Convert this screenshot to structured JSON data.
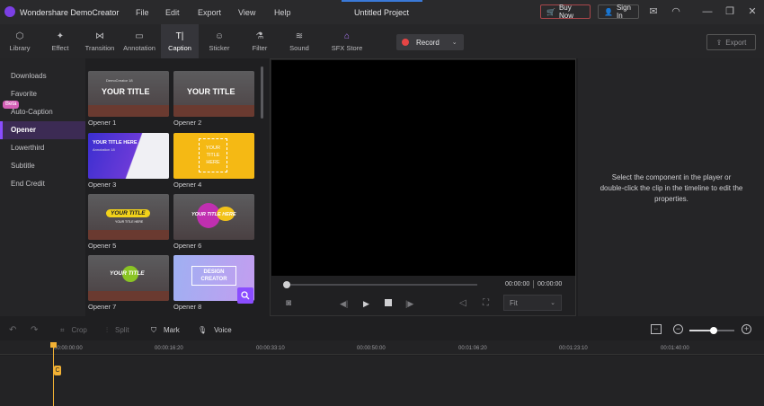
{
  "app": {
    "name": "Wondershare DemoCreator",
    "project_title": "Untitled Project"
  },
  "menu": [
    "File",
    "Edit",
    "Export",
    "View",
    "Help"
  ],
  "titlebar": {
    "buy_now": "Buy Now",
    "sign_in": "Sign In"
  },
  "toolbar": {
    "tools": [
      {
        "label": "Library",
        "icon": "cube-icon"
      },
      {
        "label": "Effect",
        "icon": "magic-wand-icon"
      },
      {
        "label": "Transition",
        "icon": "bowtie-icon"
      },
      {
        "label": "Annotation",
        "icon": "speech-bubble-icon"
      },
      {
        "label": "Caption",
        "icon": "text-cursor-icon"
      },
      {
        "label": "Sticker",
        "icon": "smiley-icon"
      },
      {
        "label": "Filter",
        "icon": "filter-icon"
      },
      {
        "label": "Sound",
        "icon": "waveform-icon"
      },
      {
        "label": "SFX Store",
        "icon": "store-icon"
      }
    ],
    "active_tool": "Caption",
    "record_label": "Record",
    "export_label": "Export"
  },
  "categories": [
    "Downloads",
    "Favorite",
    "Auto-Caption",
    "Opener",
    "Lowerthird",
    "Subtitle",
    "End Credit"
  ],
  "active_category": "Opener",
  "beta_badge": "Beta",
  "templates": [
    {
      "label": "Opener 1",
      "title": "YOUR TITLE",
      "sub": "DemoCreator 18"
    },
    {
      "label": "Opener 2",
      "title": "YOUR TITLE",
      "sub": ""
    },
    {
      "label": "Opener 3",
      "title": "YOUR TITLE HERE",
      "sub": "Annotation 18"
    },
    {
      "label": "Opener 4",
      "title": "YOUR TITLE HERE",
      "sub": ""
    },
    {
      "label": "Opener 5",
      "title": "YOUR TITLE",
      "sub": "YOUR TITLE HERE"
    },
    {
      "label": "Opener 6",
      "title": "YOUR TITLE HERE",
      "sub": ""
    },
    {
      "label": "Opener 7",
      "title": "YOUR TITLE",
      "sub": ""
    },
    {
      "label": "Opener 8",
      "title": "DESIGN CREATOR",
      "sub": ""
    }
  ],
  "player": {
    "current_time": "00:00:00",
    "total_time": "00:00:00",
    "zoom_select": "Fit"
  },
  "properties_hint": "Select the component in the player or double-click the clip in the timeline to edit the properties.",
  "timeline": {
    "tools": [
      "Crop",
      "Split",
      "Mark",
      "Voice"
    ],
    "ticks": [
      "00:00:00:00",
      "00:00:16:20",
      "00:00:33:10",
      "00:00:50:00",
      "00:01:06:20",
      "00:01:23:10",
      "00:01:40:00"
    ],
    "clip_marker": "C"
  },
  "colors": {
    "accent": "#8a4dff",
    "record": "#e64545",
    "playhead": "#f2b134"
  }
}
